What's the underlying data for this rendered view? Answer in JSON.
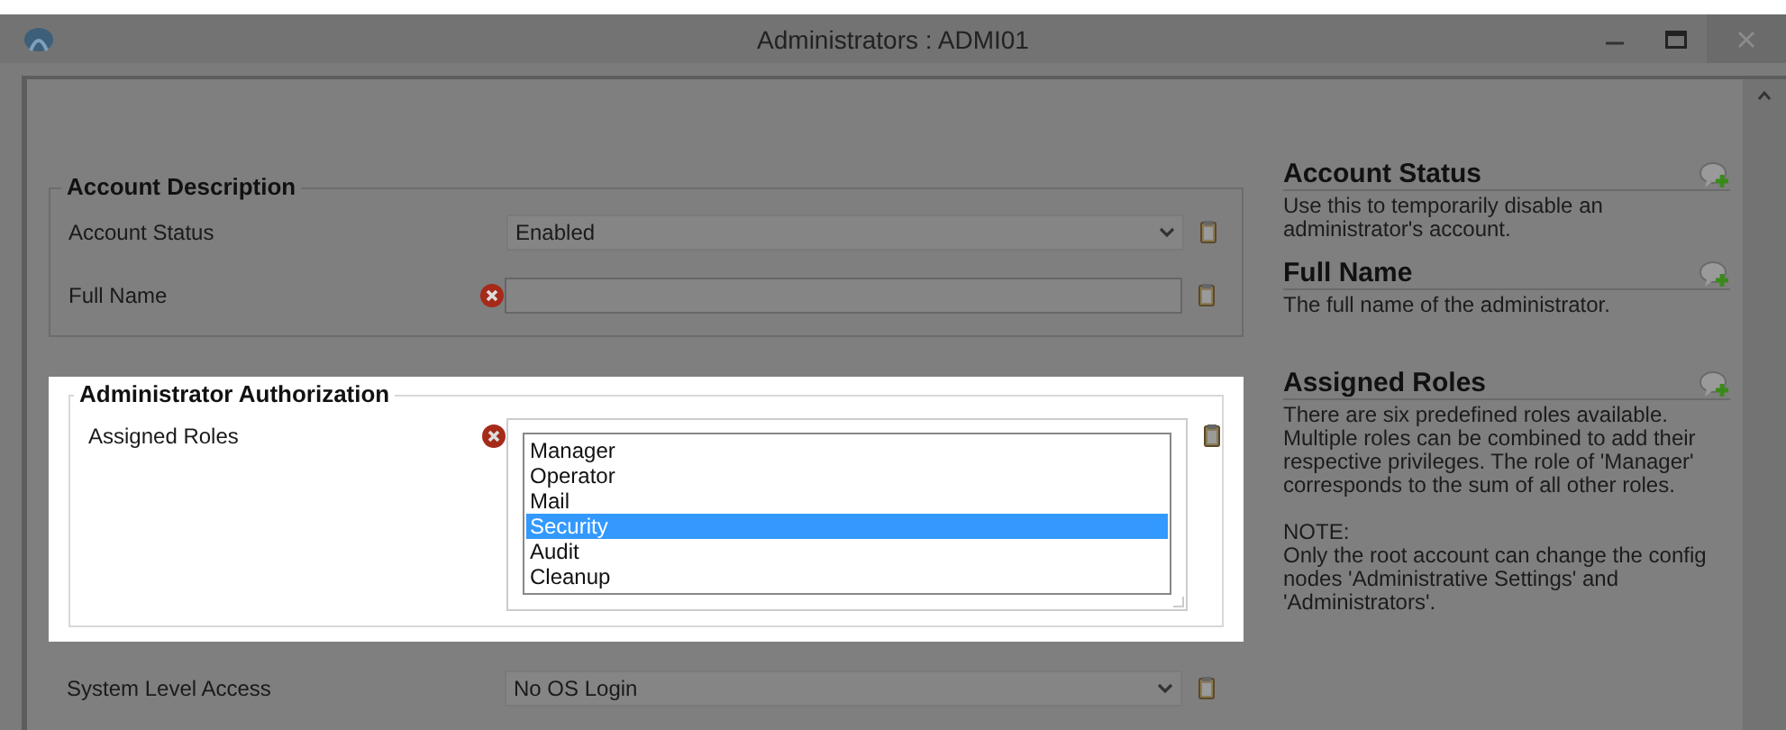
{
  "window": {
    "title": "Administrators : ADMI01"
  },
  "sections": [
    {
      "title": "Account Description",
      "highlighted": false,
      "fields": [
        {
          "label": "Account Status",
          "kind": "dropdown",
          "value": "Enabled",
          "error": false
        },
        {
          "label": "Full Name",
          "kind": "text",
          "error": true
        }
      ]
    },
    {
      "title": "Administrator Authorization",
      "highlighted": true,
      "fields": [
        {
          "label": "Assigned Roles",
          "kind": "listbox",
          "error": true,
          "options": [
            {
              "label": "Manager",
              "selected": false
            },
            {
              "label": "Operator",
              "selected": false
            },
            {
              "label": "Mail",
              "selected": false
            },
            {
              "label": "Security",
              "selected": true
            },
            {
              "label": "Audit",
              "selected": false
            },
            {
              "label": "Cleanup",
              "selected": false
            }
          ]
        }
      ]
    },
    {
      "highlighted": false,
      "fields": [
        {
          "label": "System Level Access",
          "kind": "dropdown",
          "value": "No OS Login",
          "error": false
        }
      ]
    }
  ],
  "help": [
    {
      "title": "Account Status",
      "text": "Use this to temporarily disable an administrator's account."
    },
    {
      "title": "Full Name",
      "text": "The full name of the administrator."
    },
    {
      "title": "Assigned Roles",
      "text": "There are six predefined roles available. Multiple roles can be combined to add their respective privileges. The role of 'Manager' corresponds to the sum of all other roles.\n\nNOTE:\nOnly the root account can change the config nodes 'Administrative Settings' and 'Administrators'."
    }
  ]
}
